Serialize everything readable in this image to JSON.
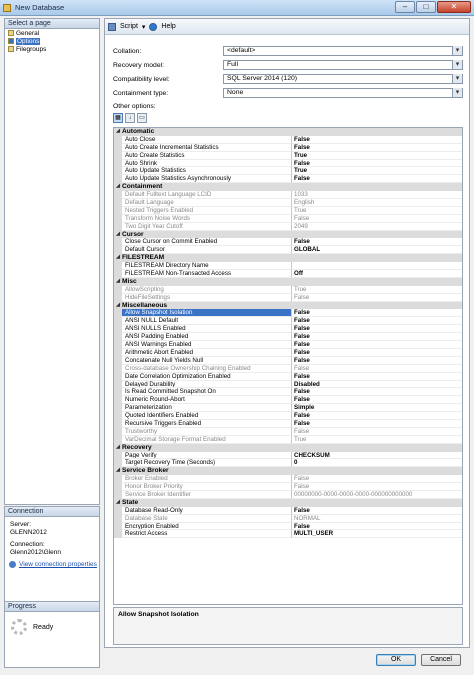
{
  "window": {
    "title": "New Database"
  },
  "left": {
    "pages_header": "Select a page",
    "pages": [
      {
        "label": "General",
        "selected": false
      },
      {
        "label": "Options",
        "selected": true
      },
      {
        "label": "Filegroups",
        "selected": false
      }
    ],
    "connection": {
      "header": "Connection",
      "server_label": "Server:",
      "server_value": "GLENN2012",
      "connection_label": "Connection:",
      "connection_value": "Glenn2012\\Glenn",
      "view_link": "View connection properties"
    },
    "progress": {
      "header": "Progress",
      "status": "Ready"
    }
  },
  "toolbar": {
    "script_label": "Script",
    "help_label": "Help"
  },
  "fields": [
    {
      "label": "Collation:",
      "value": "<default>"
    },
    {
      "label": "Recovery model:",
      "value": "Full"
    },
    {
      "label": "Compatibility level:",
      "value": "SQL Server 2014 (120)"
    },
    {
      "label": "Containment type:",
      "value": "None"
    }
  ],
  "other_options_label": "Other options:",
  "grid": [
    {
      "type": "cat",
      "name": "Automatic"
    },
    {
      "type": "prop",
      "name": "Auto Close",
      "value": "False"
    },
    {
      "type": "prop",
      "name": "Auto Create Incremental Statistics",
      "value": "False"
    },
    {
      "type": "prop",
      "name": "Auto Create Statistics",
      "value": "True"
    },
    {
      "type": "prop",
      "name": "Auto Shrink",
      "value": "False"
    },
    {
      "type": "prop",
      "name": "Auto Update Statistics",
      "value": "True"
    },
    {
      "type": "prop",
      "name": "Auto Update Statistics Asynchronously",
      "value": "False"
    },
    {
      "type": "cat",
      "name": "Containment"
    },
    {
      "type": "prop",
      "name": "Default Fulltext Language LCID",
      "value": "1033",
      "ro": true
    },
    {
      "type": "prop",
      "name": "Default Language",
      "value": "English",
      "ro": true
    },
    {
      "type": "prop",
      "name": "Nested Triggers Enabled",
      "value": "True",
      "ro": true
    },
    {
      "type": "prop",
      "name": "Transform Noise Words",
      "value": "False",
      "ro": true
    },
    {
      "type": "prop",
      "name": "Two Digit Year Cutoff",
      "value": "2049",
      "ro": true
    },
    {
      "type": "cat",
      "name": "Cursor"
    },
    {
      "type": "prop",
      "name": "Close Cursor on Commit Enabled",
      "value": "False"
    },
    {
      "type": "prop",
      "name": "Default Cursor",
      "value": "GLOBAL"
    },
    {
      "type": "cat",
      "name": "FILESTREAM"
    },
    {
      "type": "prop",
      "name": "FILESTREAM Directory Name",
      "value": ""
    },
    {
      "type": "prop",
      "name": "FILESTREAM Non-Transacted Access",
      "value": "Off"
    },
    {
      "type": "cat",
      "name": "Misc"
    },
    {
      "type": "prop",
      "name": "AllowScripting",
      "value": "True",
      "ro": true
    },
    {
      "type": "prop",
      "name": "HideFileSettings",
      "value": "False",
      "ro": true
    },
    {
      "type": "cat",
      "name": "Miscellaneous"
    },
    {
      "type": "prop",
      "name": "Allow Snapshot Isolation",
      "value": "False",
      "selected": true
    },
    {
      "type": "prop",
      "name": "ANSI NULL Default",
      "value": "False"
    },
    {
      "type": "prop",
      "name": "ANSI NULLS Enabled",
      "value": "False"
    },
    {
      "type": "prop",
      "name": "ANSI Padding Enabled",
      "value": "False"
    },
    {
      "type": "prop",
      "name": "ANSI Warnings Enabled",
      "value": "False"
    },
    {
      "type": "prop",
      "name": "Arithmetic Abort Enabled",
      "value": "False"
    },
    {
      "type": "prop",
      "name": "Concatenate Null Yields Null",
      "value": "False"
    },
    {
      "type": "prop",
      "name": "Cross-database Ownership Chaining Enabled",
      "value": "False",
      "ro": true
    },
    {
      "type": "prop",
      "name": "Date Correlation Optimization Enabled",
      "value": "False"
    },
    {
      "type": "prop",
      "name": "Delayed Durability",
      "value": "Disabled"
    },
    {
      "type": "prop",
      "name": "Is Read Committed Snapshot On",
      "value": "False"
    },
    {
      "type": "prop",
      "name": "Numeric Round-Abort",
      "value": "False"
    },
    {
      "type": "prop",
      "name": "Parameterization",
      "value": "Simple"
    },
    {
      "type": "prop",
      "name": "Quoted Identifiers Enabled",
      "value": "False"
    },
    {
      "type": "prop",
      "name": "Recursive Triggers Enabled",
      "value": "False"
    },
    {
      "type": "prop",
      "name": "Trustworthy",
      "value": "False",
      "ro": true
    },
    {
      "type": "prop",
      "name": "VarDecimal Storage Format Enabled",
      "value": "True",
      "ro": true
    },
    {
      "type": "cat",
      "name": "Recovery"
    },
    {
      "type": "prop",
      "name": "Page Verify",
      "value": "CHECKSUM"
    },
    {
      "type": "prop",
      "name": "Target Recovery Time (Seconds)",
      "value": "0"
    },
    {
      "type": "cat",
      "name": "Service Broker"
    },
    {
      "type": "prop",
      "name": "Broker Enabled",
      "value": "False",
      "ro": true
    },
    {
      "type": "prop",
      "name": "Honor Broker Priority",
      "value": "False",
      "ro": true
    },
    {
      "type": "prop",
      "name": "Service Broker Identifier",
      "value": "00000000-0000-0000-0000-000000000000",
      "ro": true
    },
    {
      "type": "cat",
      "name": "State"
    },
    {
      "type": "prop",
      "name": "Database Read-Only",
      "value": "False"
    },
    {
      "type": "prop",
      "name": "Database State",
      "value": "NORMAL",
      "ro": true
    },
    {
      "type": "prop",
      "name": "Encryption Enabled",
      "value": "False"
    },
    {
      "type": "prop",
      "name": "Restrict Access",
      "value": "MULTI_USER"
    }
  ],
  "description": "Allow Snapshot Isolation",
  "buttons": {
    "ok": "OK",
    "cancel": "Cancel"
  }
}
